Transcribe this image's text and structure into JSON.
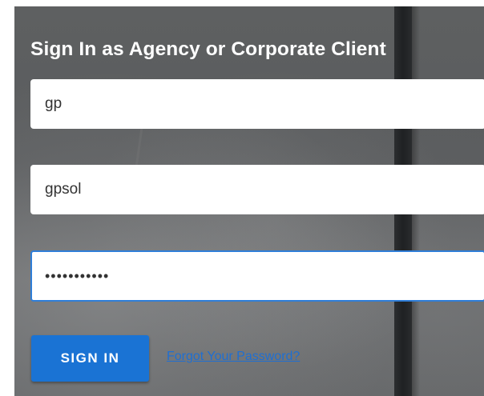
{
  "form": {
    "title": "Sign In as Agency or Corporate Client",
    "username_value": "gp",
    "company_value": "gpsol",
    "password_value": "sampletextP",
    "signin_label": "SIGN IN",
    "forgot_label": "Forgot Your Password?"
  },
  "colors": {
    "panel_background": "#5e6061",
    "button": "#1a73d4",
    "link": "#1f6fd2",
    "focus_border": "#2f7ed8"
  }
}
